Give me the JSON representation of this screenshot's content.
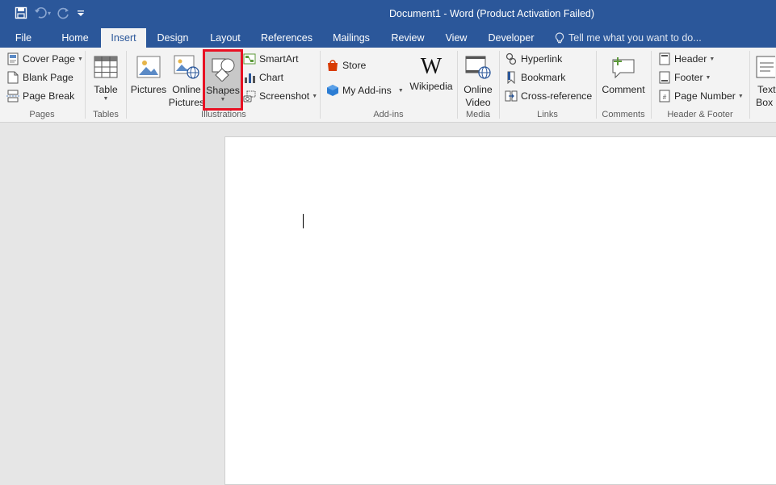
{
  "window": {
    "title": "Document1 - Word (Product Activation Failed)"
  },
  "qat": {
    "save_icon": "save-icon",
    "undo_icon": "undo-icon",
    "redo_icon": "redo-icon",
    "customize_icon": "customize-qat-icon"
  },
  "tabs": [
    {
      "label": "File"
    },
    {
      "label": "Home"
    },
    {
      "label": "Insert"
    },
    {
      "label": "Design"
    },
    {
      "label": "Layout"
    },
    {
      "label": "References"
    },
    {
      "label": "Mailings"
    },
    {
      "label": "Review"
    },
    {
      "label": "View"
    },
    {
      "label": "Developer"
    }
  ],
  "tellme": {
    "placeholder": "Tell me what you want to do..."
  },
  "ribbon": {
    "pages": {
      "label": "Pages",
      "cover_page": "Cover Page",
      "blank_page": "Blank Page",
      "page_break": "Page Break"
    },
    "tables": {
      "label": "Tables",
      "table": "Table"
    },
    "illustrations": {
      "label": "Illustrations",
      "pictures": "Pictures",
      "online_pictures_1": "Online",
      "online_pictures_2": "Pictures",
      "shapes": "Shapes",
      "smartart": "SmartArt",
      "chart": "Chart",
      "screenshot": "Screenshot"
    },
    "addins": {
      "label": "Add-ins",
      "store": "Store",
      "my_addins": "My Add-ins",
      "wikipedia": "Wikipedia"
    },
    "media": {
      "label": "Media",
      "online_video_1": "Online",
      "online_video_2": "Video"
    },
    "links": {
      "label": "Links",
      "hyperlink": "Hyperlink",
      "bookmark": "Bookmark",
      "cross_reference": "Cross-reference"
    },
    "comments": {
      "label": "Comments",
      "comment": "Comment"
    },
    "header_footer": {
      "label": "Header & Footer",
      "header": "Header",
      "footer": "Footer",
      "page_number": "Page Number"
    },
    "text": {
      "text_box_1": "Text",
      "text_box_2": "Box"
    }
  },
  "colors": {
    "accent": "#2b579a",
    "highlight": "#e81123"
  }
}
